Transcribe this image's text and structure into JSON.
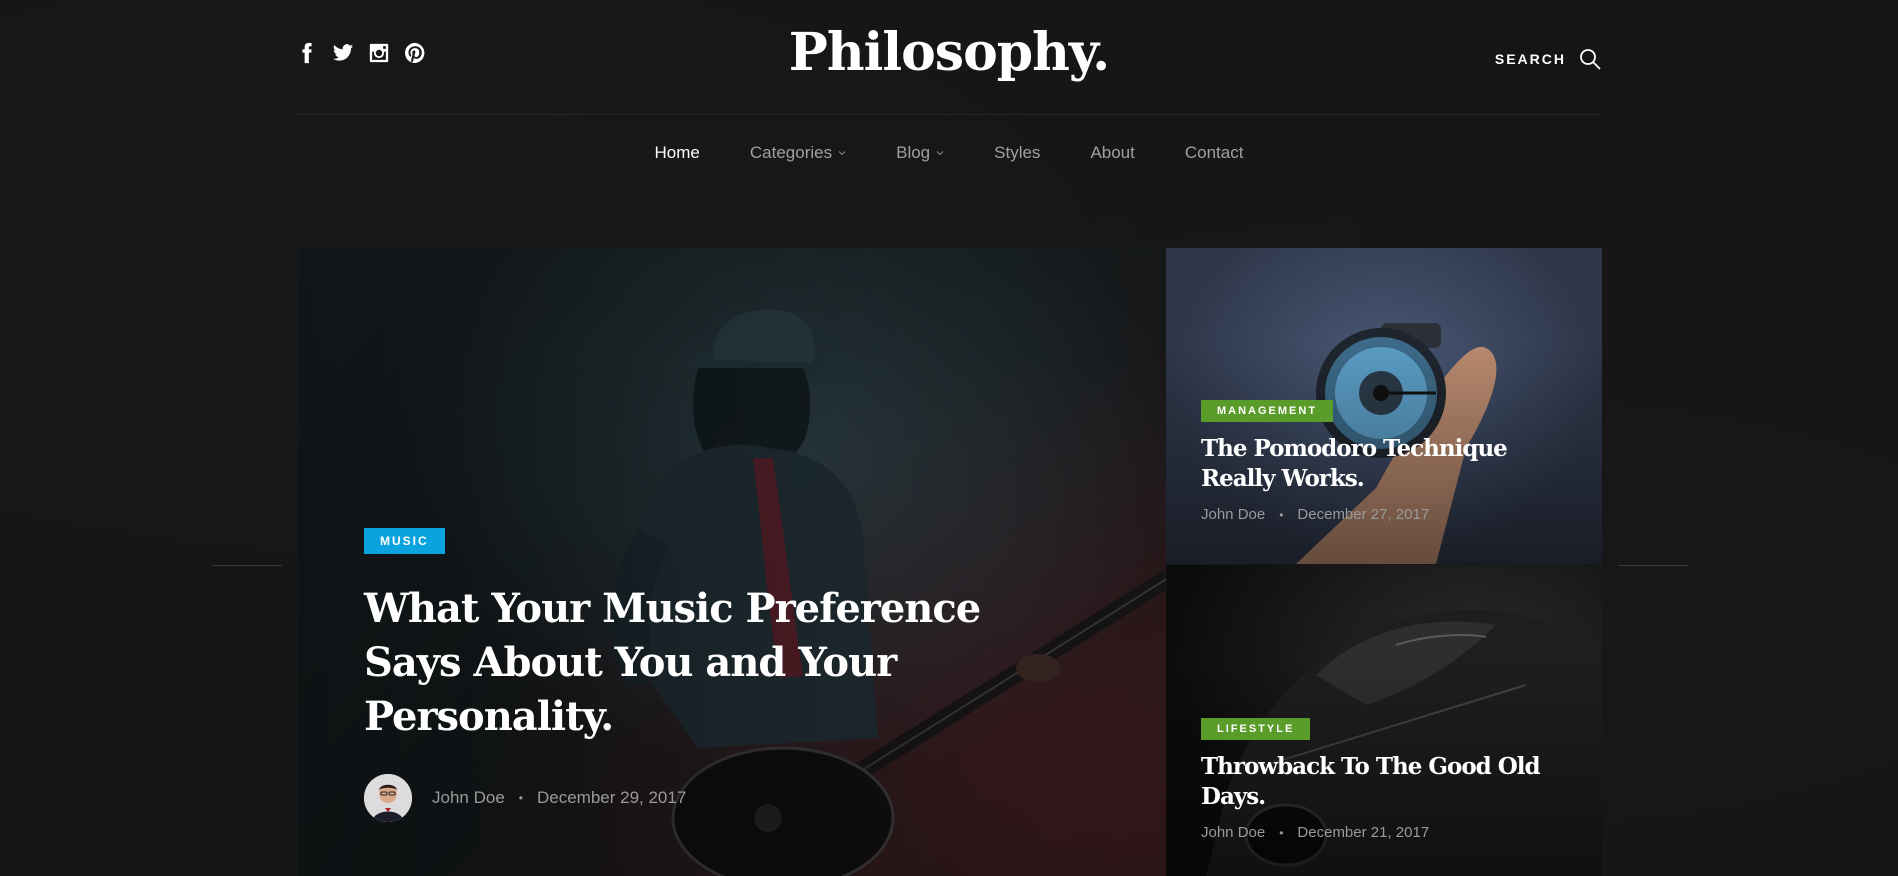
{
  "header": {
    "logo": "Philosophy.",
    "search_label": "SEARCH",
    "social": [
      "facebook-icon",
      "twitter-icon",
      "instagram-icon",
      "pinterest-icon"
    ]
  },
  "nav": {
    "items": [
      {
        "label": "Home",
        "active": true
      },
      {
        "label": "Categories",
        "dropdown": true
      },
      {
        "label": "Blog",
        "dropdown": true
      },
      {
        "label": "Styles"
      },
      {
        "label": "About"
      },
      {
        "label": "Contact"
      }
    ]
  },
  "featured": {
    "category": "MUSIC",
    "title": "What Your Music Preference Says About You and Your Personality.",
    "author": "John Doe",
    "date": "December 29, 2017"
  },
  "side_posts": [
    {
      "category": "MANAGEMENT",
      "title": "The Pomodoro Technique Really Works.",
      "author": "John Doe",
      "date": "December 27, 2017"
    },
    {
      "category": "LIFESTYLE",
      "title": "Throwback To The Good Old Days.",
      "author": "John Doe",
      "date": "December 21, 2017"
    }
  ],
  "colors": {
    "background": "#151515",
    "music_badge": "#0aa3e0",
    "category_badge": "#5a9c2a",
    "meta_text": "#9a9a9a"
  }
}
